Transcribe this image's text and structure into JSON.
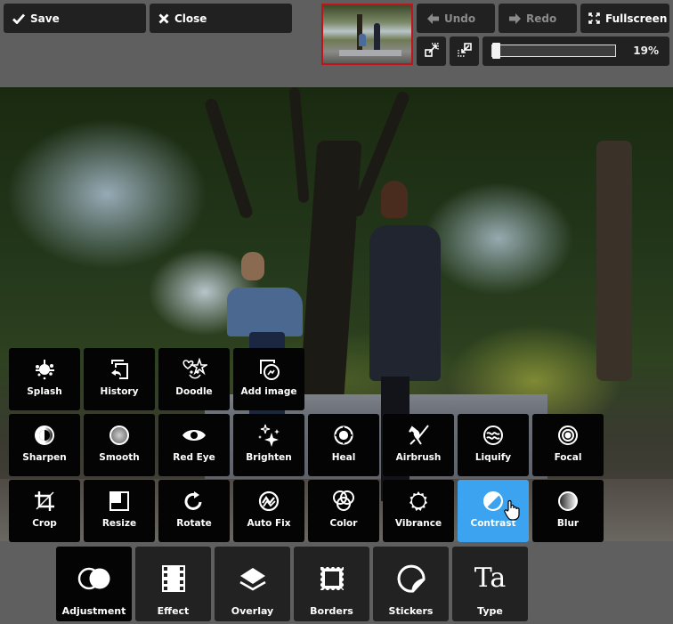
{
  "toolbar": {
    "save_label": "Save",
    "close_label": "Close",
    "undo_label": "Undo",
    "redo_label": "Redo",
    "fullscreen_label": "Fullscreen",
    "zoom_percent_label": "19%",
    "zoom_value": 19,
    "undo_enabled": false,
    "redo_enabled": false
  },
  "tools": {
    "row1": [
      {
        "id": "splash",
        "label": "Splash",
        "icon": "splash-icon"
      },
      {
        "id": "history",
        "label": "History",
        "icon": "history-icon"
      },
      {
        "id": "doodle",
        "label": "Doodle",
        "icon": "doodle-icon"
      },
      {
        "id": "add-image",
        "label": "Add image",
        "icon": "add-image-icon"
      }
    ],
    "row2": [
      {
        "id": "sharpen",
        "label": "Sharpen",
        "icon": "sharpen-icon"
      },
      {
        "id": "smooth",
        "label": "Smooth",
        "icon": "smooth-icon"
      },
      {
        "id": "red-eye",
        "label": "Red Eye",
        "icon": "eye-icon"
      },
      {
        "id": "brighten",
        "label": "Brighten",
        "icon": "sparkle-icon"
      },
      {
        "id": "heal",
        "label": "Heal",
        "icon": "heal-icon"
      },
      {
        "id": "airbrush",
        "label": "Airbrush",
        "icon": "airbrush-icon"
      },
      {
        "id": "liquify",
        "label": "Liquify",
        "icon": "liquify-icon"
      },
      {
        "id": "focal",
        "label": "Focal",
        "icon": "focal-icon"
      }
    ],
    "row3": [
      {
        "id": "crop",
        "label": "Crop",
        "icon": "crop-icon"
      },
      {
        "id": "resize",
        "label": "Resize",
        "icon": "resize-icon"
      },
      {
        "id": "rotate",
        "label": "Rotate",
        "icon": "rotate-icon"
      },
      {
        "id": "auto-fix",
        "label": "Auto Fix",
        "icon": "auto-fix-icon"
      },
      {
        "id": "color",
        "label": "Color",
        "icon": "color-icon"
      },
      {
        "id": "vibrance",
        "label": "Vibrance",
        "icon": "vibrance-icon"
      },
      {
        "id": "contrast",
        "label": "Contrast",
        "icon": "contrast-icon",
        "active": true
      },
      {
        "id": "blur",
        "label": "Blur",
        "icon": "blur-icon"
      }
    ]
  },
  "categories": [
    {
      "id": "adjustment",
      "label": "Adjustment",
      "icon": "adjustment-icon",
      "active": true
    },
    {
      "id": "effect",
      "label": "Effect",
      "icon": "film-icon"
    },
    {
      "id": "overlay",
      "label": "Overlay",
      "icon": "layers-icon"
    },
    {
      "id": "borders",
      "label": "Borders",
      "icon": "stamp-border-icon"
    },
    {
      "id": "stickers",
      "label": "Stickers",
      "icon": "sticker-icon"
    },
    {
      "id": "type",
      "label": "Type",
      "icon": "type-icon",
      "glyph": "Ta"
    }
  ],
  "colors": {
    "background": "#5f5f5f",
    "button": "#212121",
    "tile": "#040404",
    "active_tile": "#3ba3f0",
    "thumbnail_border": "#c0141c"
  }
}
